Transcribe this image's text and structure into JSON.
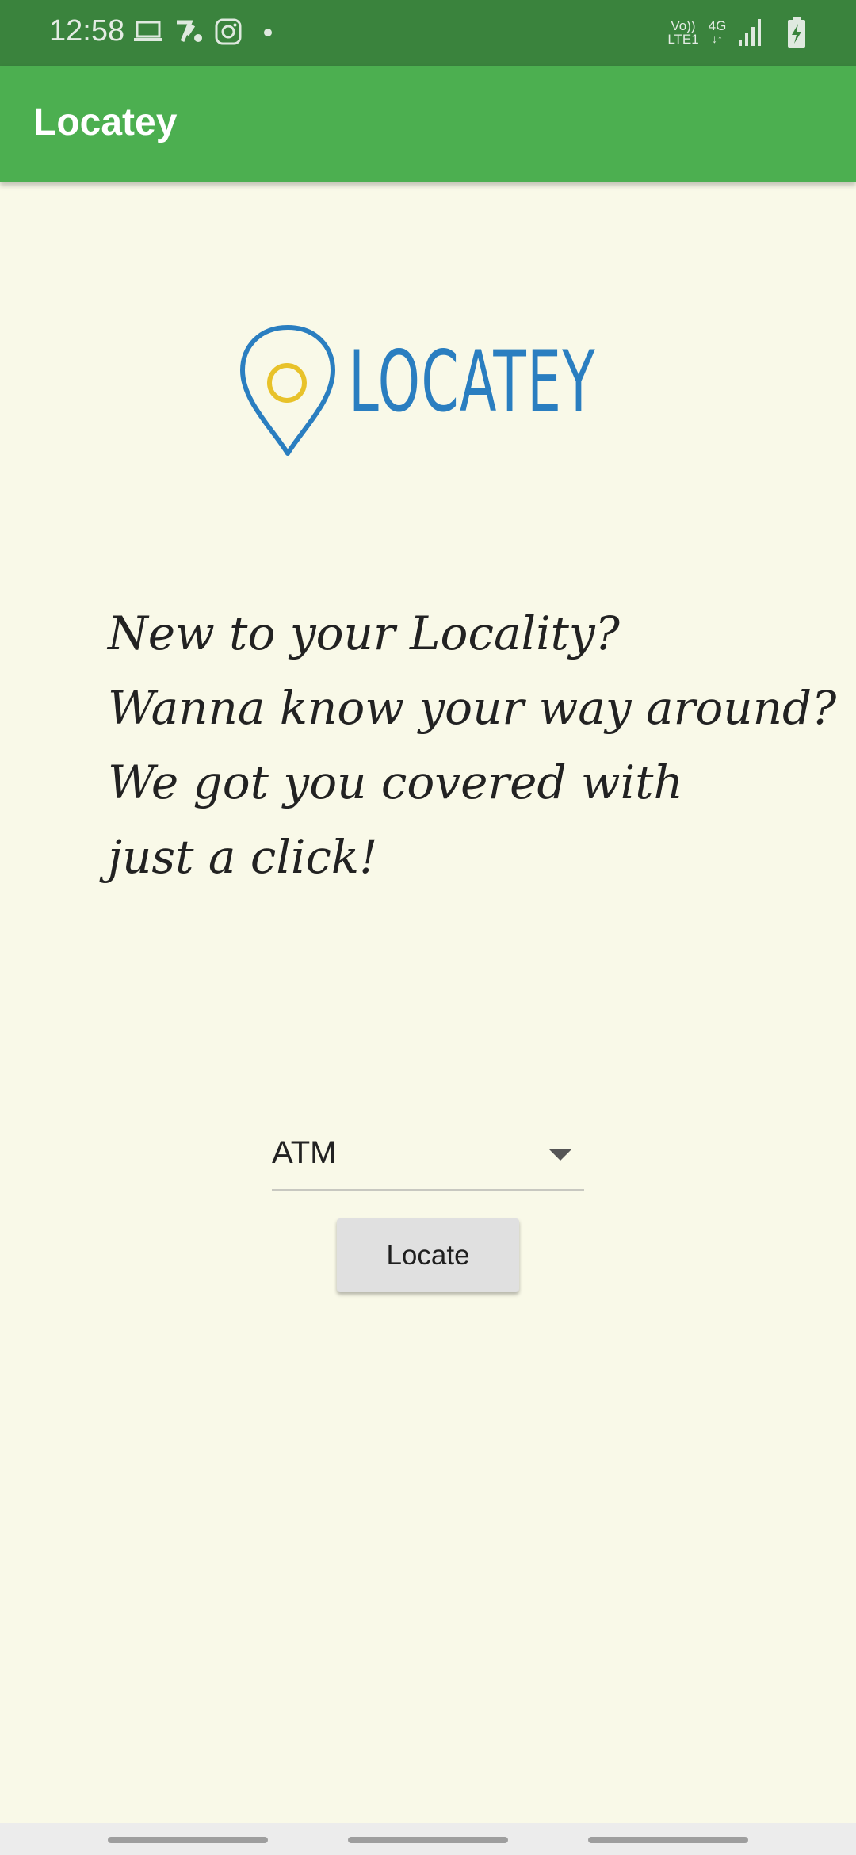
{
  "status_bar": {
    "time": "12:58",
    "icons": [
      "laptop-icon",
      "app-notification-icon",
      "instagram-icon",
      "dot-icon"
    ],
    "network": {
      "volte_line1": "Vo))",
      "volte_line2": "LTE1",
      "type": "4G"
    },
    "status_icons": [
      "signal-icon",
      "battery-charging-icon"
    ]
  },
  "app_bar": {
    "title": "Locatey"
  },
  "logo": {
    "wordmark": "LOCATEY"
  },
  "tagline": {
    "lines": [
      "New to your Locality?",
      "Wanna know your way around?",
      "We got you covered with",
      "just a click!"
    ]
  },
  "spinner": {
    "selected": "ATM"
  },
  "button": {
    "label": "Locate"
  },
  "colors": {
    "status_bar": "#3a833d",
    "app_bar": "#4caf50",
    "background": "#f9f9e8",
    "logo_blue": "#2a7ec0",
    "logo_yellow": "#e8c22a"
  }
}
